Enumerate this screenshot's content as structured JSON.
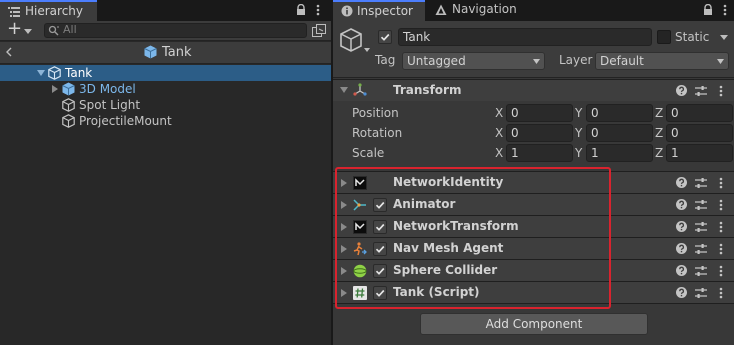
{
  "hierarchy": {
    "tab_label": "Hierarchy",
    "add_label": "+",
    "search_placeholder": "All",
    "scene_title": "Tank",
    "items": [
      {
        "label": "Tank"
      },
      {
        "label": "3D Model"
      },
      {
        "label": "Spot Light"
      },
      {
        "label": "ProjectileMount"
      }
    ]
  },
  "inspector": {
    "tabs": [
      {
        "label": "Inspector"
      },
      {
        "label": "Navigation"
      }
    ],
    "object": {
      "name": "Tank",
      "static_label": "Static",
      "tag_label": "Tag",
      "tag_value": "Untagged",
      "layer_label": "Layer",
      "layer_value": "Default"
    },
    "transform": {
      "title": "Transform",
      "rows": [
        {
          "label": "Position",
          "x": "0",
          "y": "0",
          "z": "0"
        },
        {
          "label": "Rotation",
          "x": "0",
          "y": "0",
          "z": "0"
        },
        {
          "label": "Scale",
          "x": "1",
          "y": "1",
          "z": "1"
        }
      ],
      "axis_labels": [
        "X",
        "Y",
        "Z"
      ]
    },
    "components": [
      {
        "label": "NetworkIdentity",
        "icon": "network-identity-icon",
        "has_checkbox": false
      },
      {
        "label": "Animator",
        "icon": "animator-icon",
        "has_checkbox": true
      },
      {
        "label": "NetworkTransform",
        "icon": "network-transform-icon",
        "has_checkbox": true
      },
      {
        "label": "Nav Mesh Agent",
        "icon": "nav-mesh-agent-icon",
        "has_checkbox": true
      },
      {
        "label": "Sphere Collider",
        "icon": "sphere-collider-icon",
        "has_checkbox": true
      },
      {
        "label": "Tank (Script)",
        "icon": "script-icon",
        "has_checkbox": true
      }
    ],
    "add_component_label": "Add Component"
  },
  "colors": {
    "accent": "#4c7efd",
    "selection": "#2c5d87",
    "highlight_border": "#d9232e",
    "prefab_blue": "#7cb7ea"
  }
}
